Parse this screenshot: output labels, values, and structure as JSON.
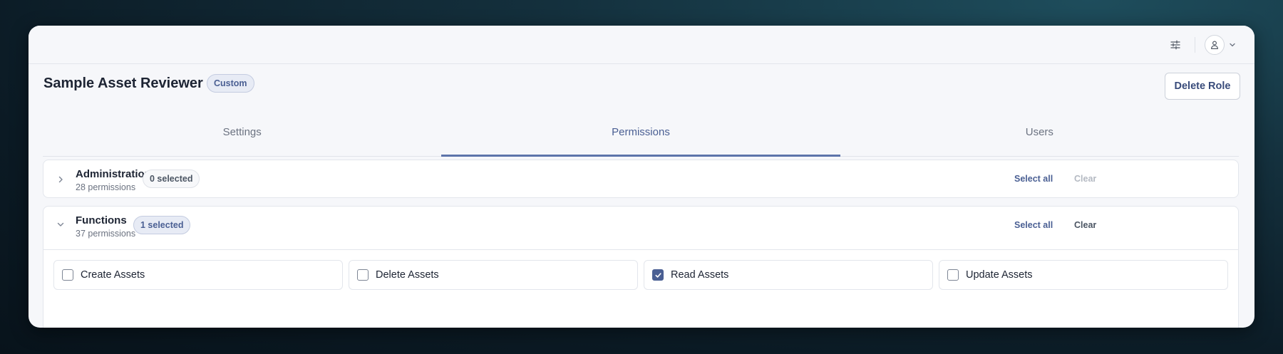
{
  "role": {
    "title": "Sample Asset Reviewer",
    "badge": "Custom",
    "delete_label": "Delete Role"
  },
  "tabs": [
    {
      "label": "Settings",
      "active": false
    },
    {
      "label": "Permissions",
      "active": true
    },
    {
      "label": "Users",
      "active": false
    }
  ],
  "groups": [
    {
      "name": "Administration",
      "count": "28 permissions",
      "selected": "0 selected",
      "expanded": false,
      "select_all": "Select all",
      "clear": "Clear"
    },
    {
      "name": "Functions",
      "count": "37 permissions",
      "selected": "1 selected",
      "expanded": true,
      "select_all": "Select all",
      "clear": "Clear",
      "permissions": [
        {
          "label": "Create Assets",
          "checked": false
        },
        {
          "label": "Delete Assets",
          "checked": false
        },
        {
          "label": "Read Assets",
          "checked": true
        },
        {
          "label": "Update Assets",
          "checked": false
        }
      ]
    }
  ],
  "icons": {
    "topbar_filter": "sliders-icon",
    "avatar": "user-icon",
    "avatar_menu": "chevron-down-icon",
    "collapsed": "chevron-right-icon",
    "expanded": "chevron-down-icon",
    "checkbox_checked": "check-icon"
  },
  "colors": {
    "accent": "#4a5f93",
    "tab_underline": "#5d74aa",
    "badge_bg": "#e7ebf5"
  }
}
